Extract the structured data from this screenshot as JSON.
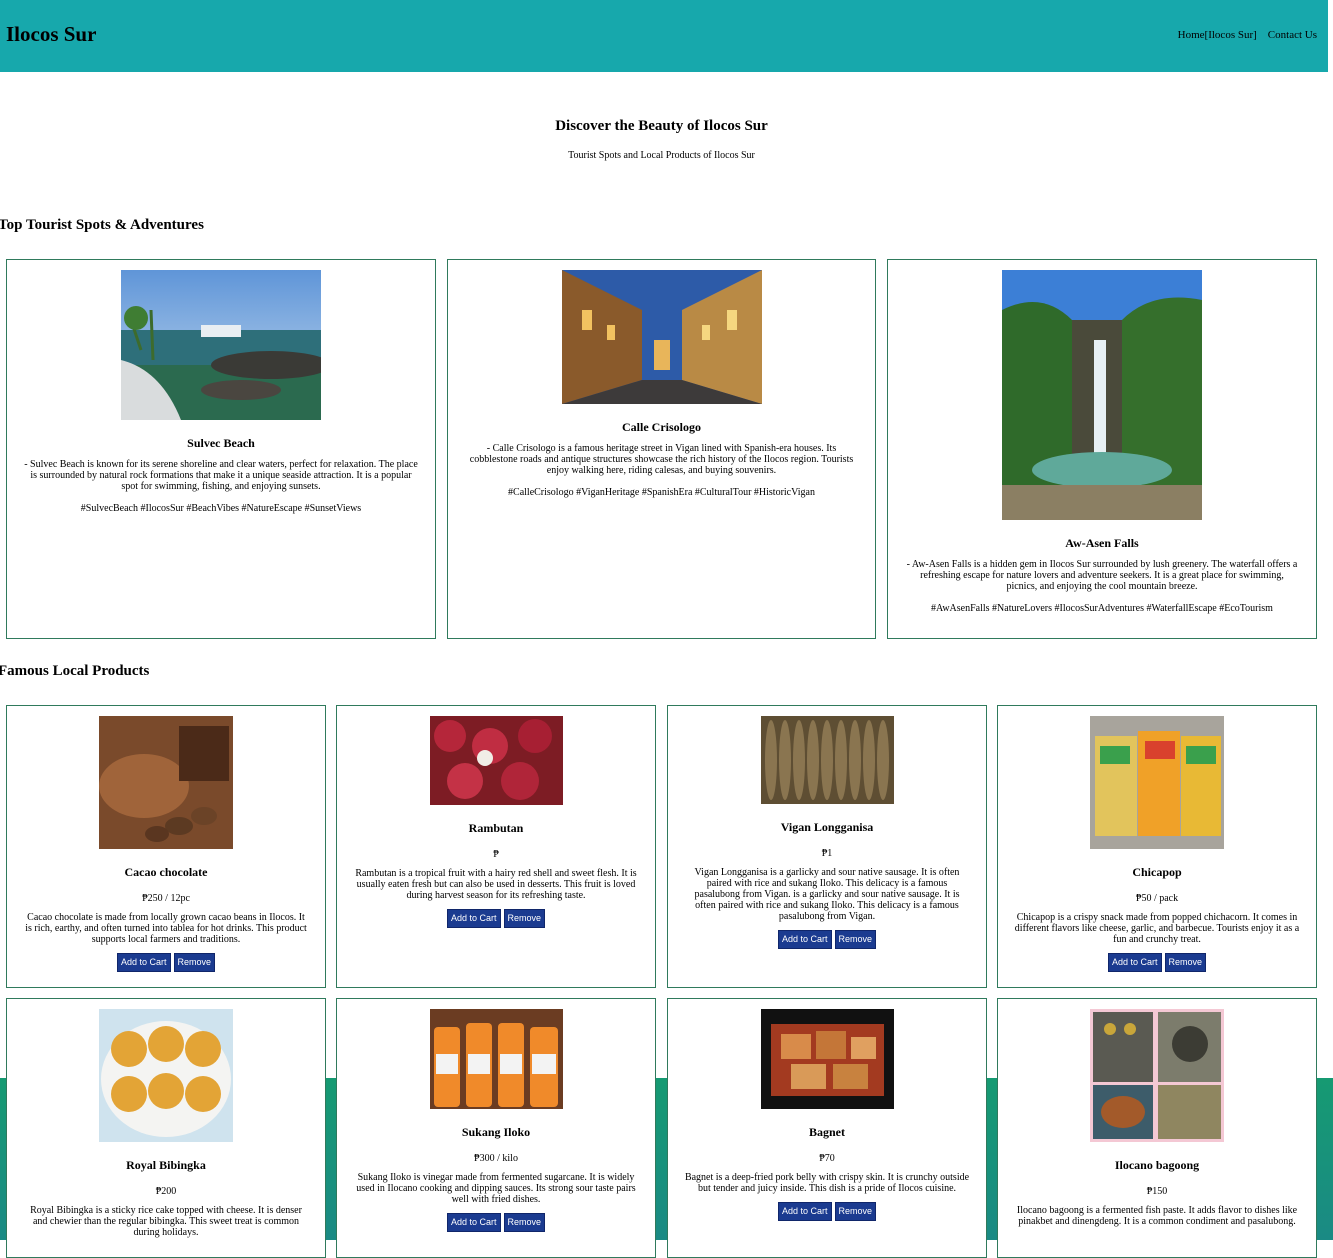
{
  "header": {
    "logo": "Ilocos Sur",
    "nav": [
      "Home[Ilocos Sur]",
      "Contact Us"
    ]
  },
  "hero": {
    "title": "Discover the Beauty of Ilocos Sur",
    "subtitle": "Tourist Spots and Local Products of Ilocos Sur"
  },
  "spots_section": {
    "title": "Top Tourist Spots & Adventures",
    "spots": [
      {
        "name": "Sulvec Beach",
        "description": "- Sulvec Beach is known for its serene shoreline and clear waters, perfect for relaxation. The place is surrounded by natural rock formations that make it a unique seaside attraction. It is a popular spot for swimming, fishing, and enjoying sunsets.",
        "tags": "#SulvecBeach #IlocosSur #BeachVibes #NatureEscape #SunsetViews"
      },
      {
        "name": "Calle Crisologo",
        "description": "- Calle Crisologo is a famous heritage street in Vigan lined with Spanish-era houses. Its cobblestone roads and antique structures showcase the rich history of the Ilocos region. Tourists enjoy walking here, riding calesas, and buying souvenirs.",
        "tags": "#CalleCrisologo #ViganHeritage #SpanishEra #CulturalTour #HistoricVigan"
      },
      {
        "name": "Aw-Asen Falls",
        "description": "- Aw-Asen Falls is a hidden gem in Ilocos Sur surrounded by lush greenery. The waterfall offers a refreshing escape for nature lovers and adventure seekers. It is a great place for swimming, picnics, and enjoying the cool mountain breeze.",
        "tags": "#AwAsenFalls #NatureLovers #IlocosSurAdventures #WaterfallEscape #EcoTourism"
      }
    ]
  },
  "products_section": {
    "title": "Famous Local Products",
    "add_label": "Add to Cart",
    "remove_label": "Remove",
    "products": [
      {
        "name": "Cacao chocolate",
        "price": "₱250 / 12pc",
        "description": "Cacao chocolate is made from locally grown cacao beans in Ilocos. It is rich, earthy, and often turned into tablea for hot drinks. This product supports local farmers and traditions."
      },
      {
        "name": "Rambutan",
        "price": "₱",
        "description": "Rambutan is a tropical fruit with a hairy red shell and sweet flesh. It is usually eaten fresh but can also be used in desserts. This fruit is loved during harvest season for its refreshing taste."
      },
      {
        "name": "Vigan Longganisa",
        "price": "₱1",
        "description": "Vigan Longganisa is a garlicky and sour native sausage. It is often paired with rice and sukang Iloko. This delicacy is a famous pasalubong from Vigan. is a garlicky and sour native sausage. It is often paired with rice and sukang Iloko. This delicacy is a famous pasalubong from Vigan."
      },
      {
        "name": "Chicapop",
        "price": "₱50 / pack",
        "description": "Chicapop is a crispy snack made from popped chichacorn. It comes in different flavors like cheese, garlic, and barbecue. Tourists enjoy it as a fun and crunchy treat."
      },
      {
        "name": "Royal Bibingka",
        "price": "₱200",
        "description": "Royal Bibingka is a sticky rice cake topped with cheese. It is denser and chewier than the regular bibingka. This sweet treat is common during holidays."
      },
      {
        "name": "Sukang Iloko",
        "price": "₱300 / kilo",
        "description": "Sukang Iloko is vinegar made from fermented sugarcane. It is widely used in Ilocano cooking and dipping sauces. Its strong sour taste pairs well with fried dishes."
      },
      {
        "name": "Bagnet",
        "price": "₱70",
        "description": "Bagnet is a deep-fried pork belly with crispy skin. It is crunchy outside but tender and juicy inside. This dish is a pride of Ilocos cuisine."
      },
      {
        "name": "Ilocano bagoong",
        "price": "₱150",
        "description": "Ilocano bagoong is a fermented fish paste. It adds flavor to dishes like pinakbet and dinengdeng. It is a common condiment and pasalubong."
      }
    ]
  }
}
